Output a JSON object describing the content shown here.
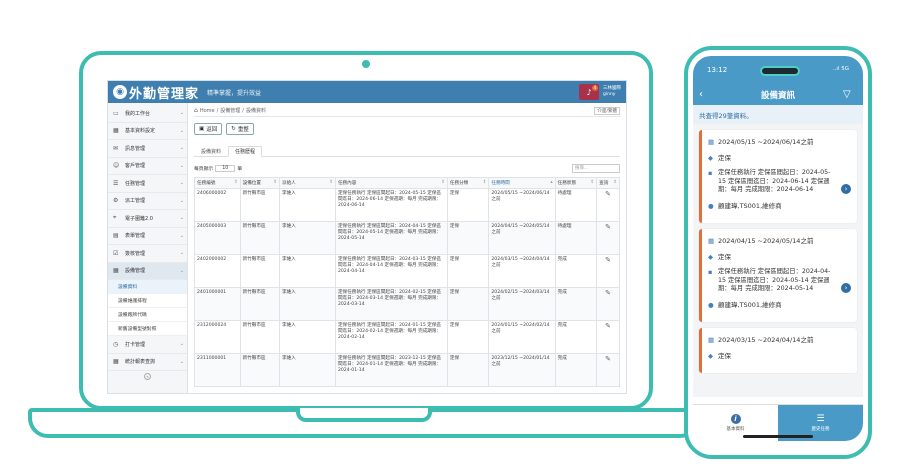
{
  "desktop": {
    "app_name": "外勤管理家",
    "header_sub": "精準掌握，提升效益",
    "bell_count": "4",
    "user_line1": "三林國際",
    "user_line2": "ginny",
    "sidebar": [
      {
        "label": "我的工作台",
        "icon": "monitor-icon",
        "glyph": "▭"
      },
      {
        "label": "基本資料設定",
        "icon": "grid-icon",
        "glyph": "▦"
      },
      {
        "label": "訊息管理",
        "icon": "chat-icon",
        "glyph": "✉"
      },
      {
        "label": "客戶管理",
        "icon": "users-icon",
        "glyph": "☺"
      },
      {
        "label": "任務管理",
        "icon": "list-icon",
        "glyph": "☰"
      },
      {
        "label": "派工管理",
        "icon": "sitemap-icon",
        "glyph": "⚙"
      },
      {
        "label": "電子圍籬2.0",
        "icon": "location-icon",
        "glyph": "⌖"
      },
      {
        "label": "表單管理",
        "icon": "form-icon",
        "glyph": "▤"
      },
      {
        "label": "簽核管理",
        "icon": "check-icon",
        "glyph": "☑"
      },
      {
        "label": "設備管理",
        "icon": "equipment-icon",
        "glyph": "▦"
      }
    ],
    "sidebar_sub": [
      "設備資料",
      "設備維護排程",
      "設備廠牌代碼",
      "新舊設備型號對照"
    ],
    "sidebar_bottom": [
      {
        "label": "打卡管理",
        "icon": "clock-icon",
        "glyph": "◷"
      },
      {
        "label": "統計報表查詢",
        "icon": "report-icon",
        "glyph": "▦"
      }
    ],
    "breadcrumb": [
      "Home",
      "設備管理",
      "設備資料"
    ],
    "lang_label": "介面/繁體",
    "buttons": {
      "back": "返回",
      "refresh": "重整"
    },
    "tabs": [
      "設備資料",
      "任務歷程"
    ],
    "table_tools": {
      "prefix": "每頁顯示",
      "page_len": "10",
      "suffix": "筆",
      "search_placeholder": "搜尋..."
    },
    "columns": [
      "任務編號",
      "設備位置",
      "派給人",
      "任務內容",
      "任務分類",
      "任務時間",
      "任務狀態",
      "查詢"
    ],
    "rows": [
      {
        "id": "2406000002",
        "loc": "新竹縣市區",
        "assignee": "李維入",
        "content": "定保任務執行 定保區間起日：2024-05-15 定保區間迄日：2024-06-14 定保週期：每月 完成期限：2024-06-14",
        "cat": "定保",
        "time": "2024/05/15 ~2024/06/14之前",
        "status": "待處理"
      },
      {
        "id": "2405000003",
        "loc": "新竹縣市區",
        "assignee": "李維入",
        "content": "定保任務執行 定保區間起日：2024-04-15 定保區間迄日：2024-05-14 定保週期：每月 完成期限：2024-05-14",
        "cat": "定保",
        "time": "2024/04/15 ~2024/05/14之前",
        "status": "待處理"
      },
      {
        "id": "2402000002",
        "loc": "新竹縣市區",
        "assignee": "李維入",
        "content": "定保任務執行 定保區間起日：2024-03-15 定保區間迄日：2024-04-14 定保週期：每月 完成期限：2024-04-14",
        "cat": "定保",
        "time": "2024/03/15 ~2024/04/14之前",
        "status": "完成"
      },
      {
        "id": "2401000001",
        "loc": "新竹縣市區",
        "assignee": "李維入",
        "content": "定保任務執行 定保區間起日：2024-02-15 定保區間迄日：2024-03-14 定保週期：每月 完成期限：2024-03-14",
        "cat": "定保",
        "time": "2024/02/15 ~2024/03/14之前",
        "status": "完成"
      },
      {
        "id": "2312000024",
        "loc": "新竹縣市區",
        "assignee": "李維入",
        "content": "定保任務執行 定保區間起日：2024-01-15 定保區間迄日：2024-02-14 定保週期：每月 完成期限：2024-02-14",
        "cat": "定保",
        "time": "2024/01/15 ~2024/02/14之前",
        "status": "完成"
      },
      {
        "id": "2311000001",
        "loc": "新竹縣市區",
        "assignee": "李維入",
        "content": "定保任務執行 定保區間起日：2023-12-15 定保區間迄日：2024-01-14 定保週期：每月 完成期限：2024-01-14",
        "cat": "定保",
        "time": "2023/12/15 ~2024/01/14之前",
        "status": "完成"
      }
    ]
  },
  "mobile": {
    "time": "13:12",
    "signal": "..ıl 5G",
    "title": "設備資訊",
    "count_text": "共查得29筆資料。",
    "cards": [
      {
        "period": "2024/05/15 ~2024/06/14之前",
        "cat": "定保",
        "desc": "定保任務執行 定保區間起日：2024-05-15 定保區間迄日：2024-06-14 定保週期：每月 完成期限：2024-06-14",
        "assignee": "顧建瑋,TS001,維修商"
      },
      {
        "period": "2024/04/15 ~2024/05/14之前",
        "cat": "定保",
        "desc": "定保任務執行 定保區間起日：2024-04-15 定保區間迄日：2024-05-14 定保週期：每月 完成期限：2024-05-14",
        "assignee": "顧建瑋,TS001,維修商"
      },
      {
        "period": "2024/03/15 ~2024/04/14之前",
        "cat": "定保"
      }
    ],
    "bottom_nav": [
      "基本資料",
      "歷史任務"
    ]
  }
}
